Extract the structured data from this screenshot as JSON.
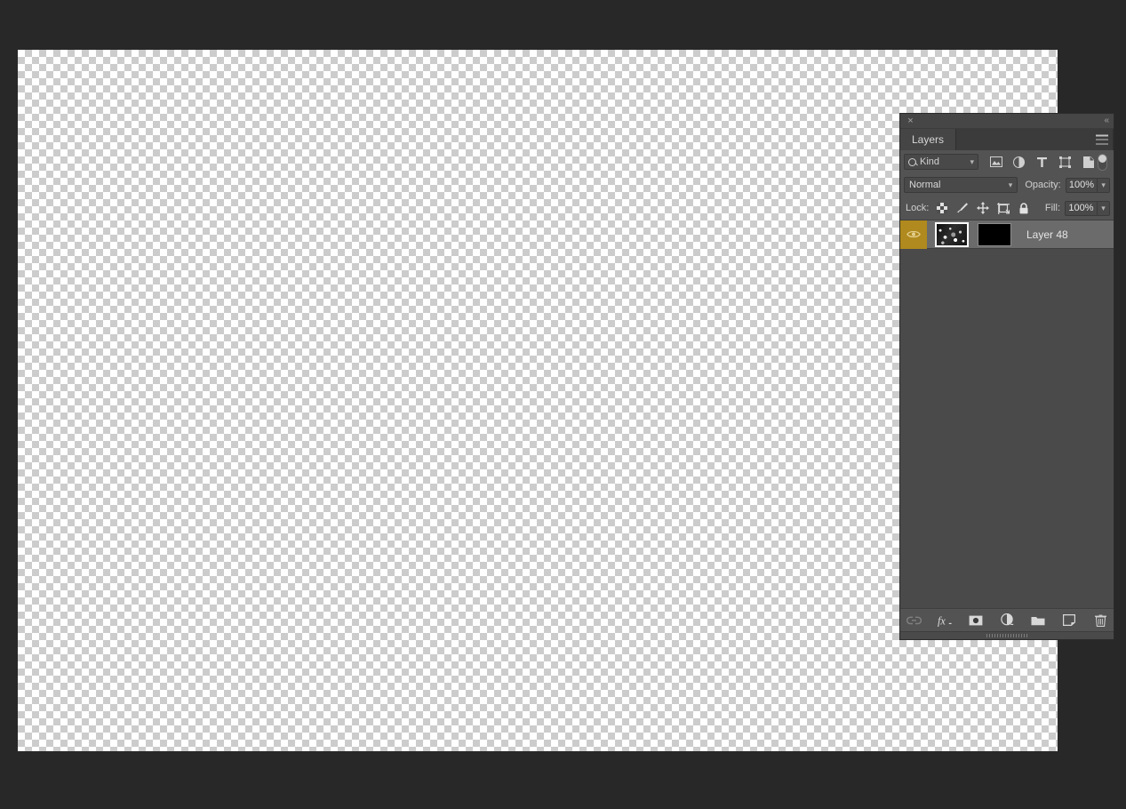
{
  "window": {
    "background_color": "#282828"
  },
  "canvas": {
    "name": "transparent-canvas",
    "checker_light": "#ffffff",
    "checker_dark": "#cccccc",
    "checker_size_px": 8
  },
  "panel": {
    "close_label": "×",
    "collapse_label": "«",
    "tabs": [
      {
        "label": "Layers",
        "active": true
      },
      {
        "label": "",
        "active": false
      }
    ],
    "menu_label": "panel-menu",
    "filter": {
      "kind_label": "Kind",
      "icons": [
        "pixel-layer-filter-icon",
        "adjustment-layer-filter-icon",
        "type-layer-filter-icon",
        "shape-layer-filter-icon",
        "smart-object-filter-icon"
      ],
      "toggle_label": "filter-enable-toggle"
    },
    "blend": {
      "mode": "Normal",
      "opacity_label": "Opacity:",
      "opacity_value": "100%"
    },
    "lock": {
      "label": "Lock:",
      "icons": [
        "lock-transparent-pixels-icon",
        "lock-image-pixels-icon",
        "lock-position-icon",
        "lock-artboard-nesting-icon",
        "lock-all-icon"
      ],
      "fill_label": "Fill:",
      "fill_value": "100%"
    },
    "layers": [
      {
        "name": "Layer 48",
        "visible": true,
        "selected": true,
        "has_mask": true,
        "mask_color": "#000000",
        "visibility_cell_color": "#b08a1e"
      }
    ],
    "footer_buttons": [
      {
        "name": "link-layers-button",
        "label": "link",
        "disabled": true
      },
      {
        "name": "layer-styles-button",
        "label": "fx",
        "disabled": false
      },
      {
        "name": "add-layer-mask-button",
        "label": "mask",
        "disabled": false
      },
      {
        "name": "new-adjustment-layer-button",
        "label": "adjustment",
        "disabled": false
      },
      {
        "name": "new-group-button",
        "label": "group",
        "disabled": false
      },
      {
        "name": "new-layer-button",
        "label": "new-layer",
        "disabled": false
      },
      {
        "name": "delete-layer-button",
        "label": "delete",
        "disabled": false
      }
    ]
  },
  "colors": {
    "panel_bg": "#535353",
    "list_bg": "#4a4a4a",
    "row_selected": "#6b6b6b",
    "accent_gold": "#b08a1e",
    "text": "#d8d8d8"
  }
}
